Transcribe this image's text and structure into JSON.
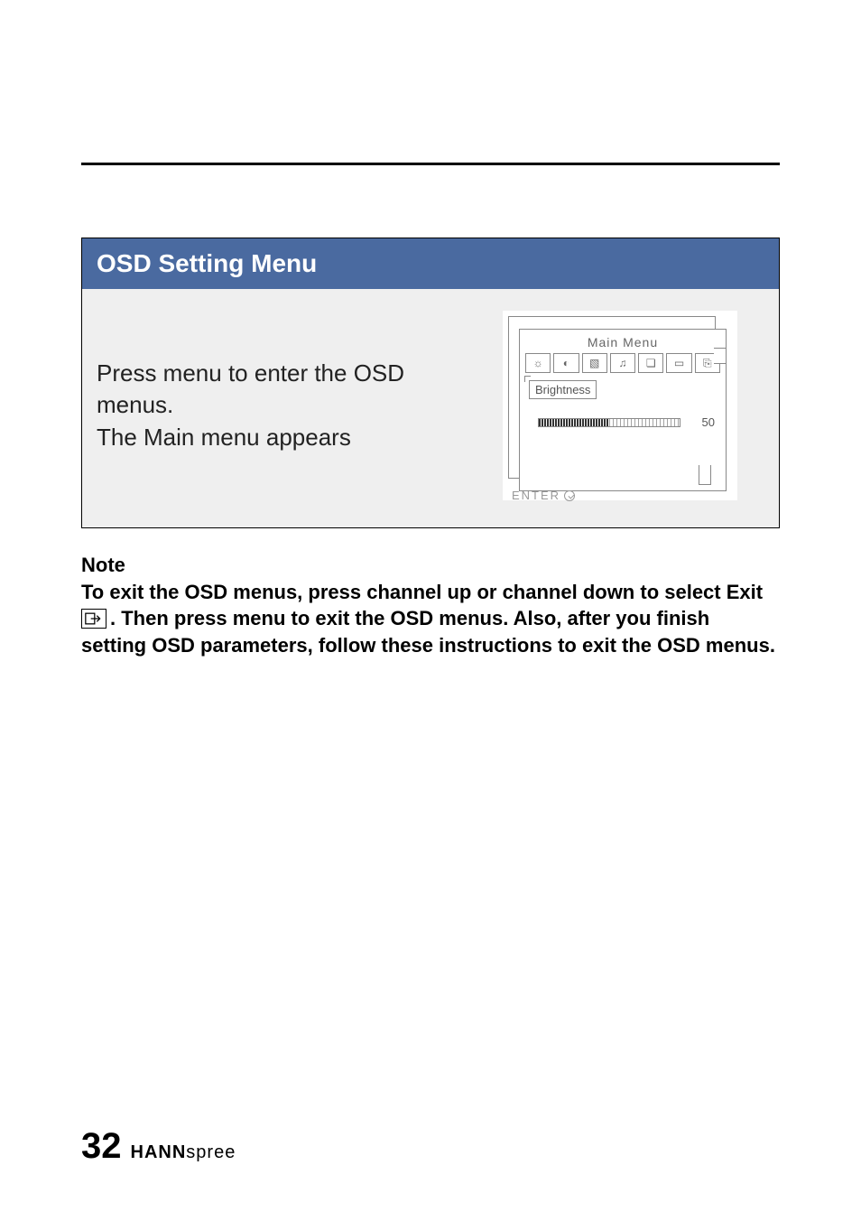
{
  "section": {
    "title": "OSD Setting Menu",
    "instruction_line1": "Press menu to enter the OSD menus.",
    "instruction_line2": "The Main menu appears"
  },
  "osd": {
    "main_menu_label": "Main Menu",
    "param_label": "Brightness",
    "value": "50",
    "enter_label": "ENTER",
    "icons": [
      "brightness-icon",
      "contrast-icon",
      "picture-icon",
      "audio-icon",
      "page-icon",
      "tv-icon",
      "exit-icon"
    ]
  },
  "note": {
    "heading": "Note",
    "line1": "To exit the OSD menus, press channel up or channel down to select Exit",
    "line2_after_icon": ". Then press menu to exit the OSD menus. Also, after you finish setting OSD parameters, follow these instructions to exit the OSD menus."
  },
  "footer": {
    "page_number": "32",
    "brand_bold": "HANN",
    "brand_light": "spree"
  }
}
